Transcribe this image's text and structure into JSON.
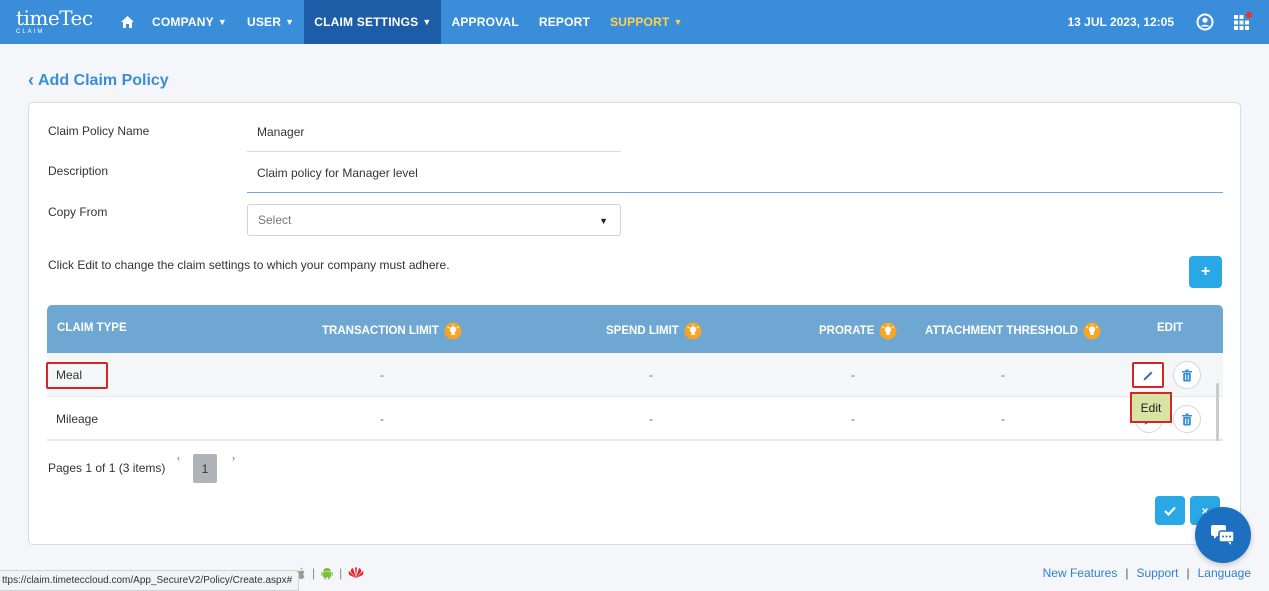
{
  "app": {
    "logo_text": "timeTec",
    "logo_sub": "CLAIM"
  },
  "nav": {
    "items": [
      {
        "label": "COMPANY",
        "has_caret": true
      },
      {
        "label": "USER",
        "has_caret": true
      },
      {
        "label": "CLAIM SETTINGS",
        "has_caret": true,
        "active": true
      },
      {
        "label": "APPROVAL"
      },
      {
        "label": "REPORT"
      },
      {
        "label": "SUPPORT",
        "has_caret": true
      }
    ],
    "datetime": "13 JUL 2023, 12:05"
  },
  "page": {
    "title": "Add Claim Policy",
    "back_icon": "chevron-left-icon"
  },
  "form": {
    "name_label": "Claim Policy Name",
    "name_value": "Manager",
    "desc_label": "Description",
    "desc_value": "Claim policy for Manager level",
    "copy_label": "Copy From",
    "copy_value": "Select"
  },
  "instructions": "Click Edit to change the claim settings to which your company must adhere.",
  "add_button_label": "+",
  "table": {
    "headers": {
      "claim_type": "CLAIM TYPE",
      "transaction_limit": "TRANSACTION LIMIT",
      "spend_limit": "SPEND LIMIT",
      "prorate": "PRORATE",
      "attachment_threshold": "ATTACHMENT THRESHOLD",
      "edit": "EDIT"
    },
    "rows": [
      {
        "claim_type": "Meal",
        "transaction_limit": "-",
        "spend_limit": "-",
        "prorate": "-",
        "attachment_threshold": "-"
      },
      {
        "claim_type": "Mileage",
        "transaction_limit": "-",
        "spend_limit": "-",
        "prorate": "-",
        "attachment_threshold": "-"
      }
    ]
  },
  "tooltip": "Edit",
  "pager": {
    "text": "Pages 1 of 1 (3 items)",
    "prev": "‹",
    "next": "›",
    "page": "1"
  },
  "close_label": "×",
  "footer": {
    "right": {
      "new_features": "New Features",
      "support": "Support",
      "language": "Language"
    }
  },
  "status_url": "ttps://claim.timeteccloud.com/App_SecureV2/Policy/Create.aspx#",
  "colors": {
    "nav_bg": "#3a8dd8",
    "nav_active": "#1d5da8",
    "support_text": "#ffd24d",
    "table_header": "#6fa7d3",
    "highlight": "#d3262b",
    "accent_button": "#29a8e6"
  }
}
